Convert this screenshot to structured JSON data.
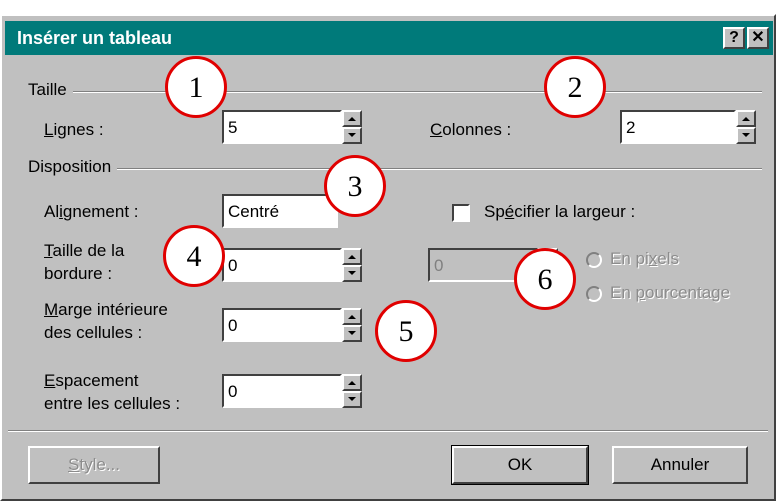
{
  "dialog": {
    "title": "Insérer un tableau",
    "help_glyph": "?",
    "close_glyph": "✕"
  },
  "taille": {
    "group_label": "Taille",
    "lignes_label_u": "L",
    "lignes_label_rest": "ignes :",
    "lignes_value": "5",
    "colonnes_label_u": "C",
    "colonnes_label_rest": "olonnes :",
    "colonnes_value": "2"
  },
  "disposition": {
    "group_label": "Disposition",
    "alignement_label_a": "Al",
    "alignement_label_u": "i",
    "alignement_label_rest": "gnement :",
    "alignement_value": "Centré",
    "bordure_label_u": "T",
    "bordure_label_line1_rest": "aille de la",
    "bordure_label_line2": "bordure :",
    "bordure_value": "0",
    "marge_label_u": "M",
    "marge_label_line1_rest": "arge intérieure",
    "marge_label_line2": "des cellules :",
    "marge_value": "0",
    "espacement_label_u": "E",
    "espacement_label_line1_rest": "spacement",
    "espacement_label_line2": "entre les cellules :",
    "espacement_value": "0",
    "specifier_label_a": "Sp",
    "specifier_label_u": "é",
    "specifier_label_rest": "cifier la largeur :",
    "largeur_value": "0",
    "pixels_label_a": "En pi",
    "pixels_label_u": "x",
    "pixels_label_rest": "els",
    "pourcentage_label_a": "En ",
    "pourcentage_label_u": "p",
    "pourcentage_label_rest": "ourcentage"
  },
  "buttons": {
    "style_u": "S",
    "style_rest": "tyle...",
    "ok": "OK",
    "annuler": "Annuler"
  },
  "markers": [
    "1",
    "2",
    "3",
    "4",
    "5",
    "6"
  ],
  "colors": {
    "title_bar": "#007a7a",
    "dialog_face": "#c0c0c0",
    "marker_ring": "#e00000"
  }
}
